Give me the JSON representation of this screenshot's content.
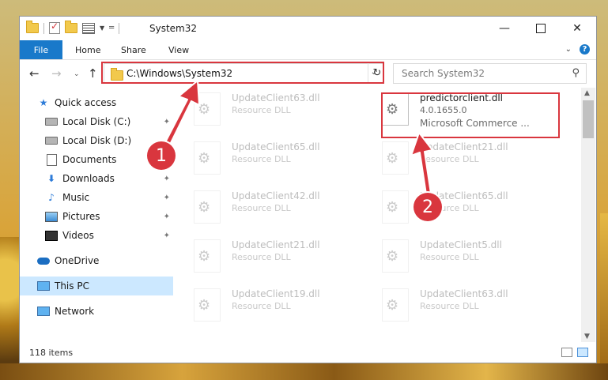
{
  "window": {
    "title": "System32",
    "ribbon_tabs": [
      "File",
      "Home",
      "Share",
      "View"
    ]
  },
  "nav": {
    "address": "C:\\Windows\\System32",
    "search_placeholder": "Search System32"
  },
  "sidebar": {
    "items": [
      {
        "label": "Quick access",
        "icon": "star-icon",
        "pinned": false
      },
      {
        "label": "Local Disk (C:)",
        "icon": "drive-icon",
        "pinned": true
      },
      {
        "label": "Local Disk (D:)",
        "icon": "drive-icon",
        "pinned": false
      },
      {
        "label": "Documents",
        "icon": "documents-icon",
        "pinned": true
      },
      {
        "label": "Downloads",
        "icon": "downloads-icon",
        "pinned": true
      },
      {
        "label": "Music",
        "icon": "music-icon",
        "pinned": true
      },
      {
        "label": "Pictures",
        "icon": "pictures-icon",
        "pinned": true
      },
      {
        "label": "Videos",
        "icon": "videos-icon",
        "pinned": true
      },
      {
        "label": "OneDrive",
        "icon": "onedrive-icon",
        "pinned": false
      },
      {
        "label": "This PC",
        "icon": "this-pc-icon",
        "pinned": false,
        "selected": true
      },
      {
        "label": "Network",
        "icon": "network-icon",
        "pinned": false
      }
    ]
  },
  "files": {
    "left": [
      {
        "name": "UpdateClient63.dll",
        "desc": "Resource DLL"
      },
      {
        "name": "UpdateClient65.dll",
        "desc": "Resource DLL"
      },
      {
        "name": "UpdateClient42.dll",
        "desc": "Resource DLL"
      },
      {
        "name": "UpdateClient21.dll",
        "desc": "Resource DLL"
      },
      {
        "name": "UpdateClient19.dll",
        "desc": "Resource DLL"
      }
    ],
    "right": [
      {
        "name": "predictorclient.dll",
        "version": "4.0.1655.0",
        "desc": "Microsoft Commerce ...",
        "highlighted": true
      },
      {
        "name": "UpdateClient21.dll",
        "desc": "Resource DLL"
      },
      {
        "name": "UpdateClient65.dll",
        "desc": "Resource DLL"
      },
      {
        "name": "UpdateClient5.dll",
        "desc": "Resource DLL"
      },
      {
        "name": "UpdateClient63.dll",
        "desc": "Resource DLL"
      }
    ]
  },
  "status": {
    "item_count": "118 items"
  },
  "annotations": {
    "step1": "1",
    "step2": "2",
    "color": "#d9363e"
  }
}
